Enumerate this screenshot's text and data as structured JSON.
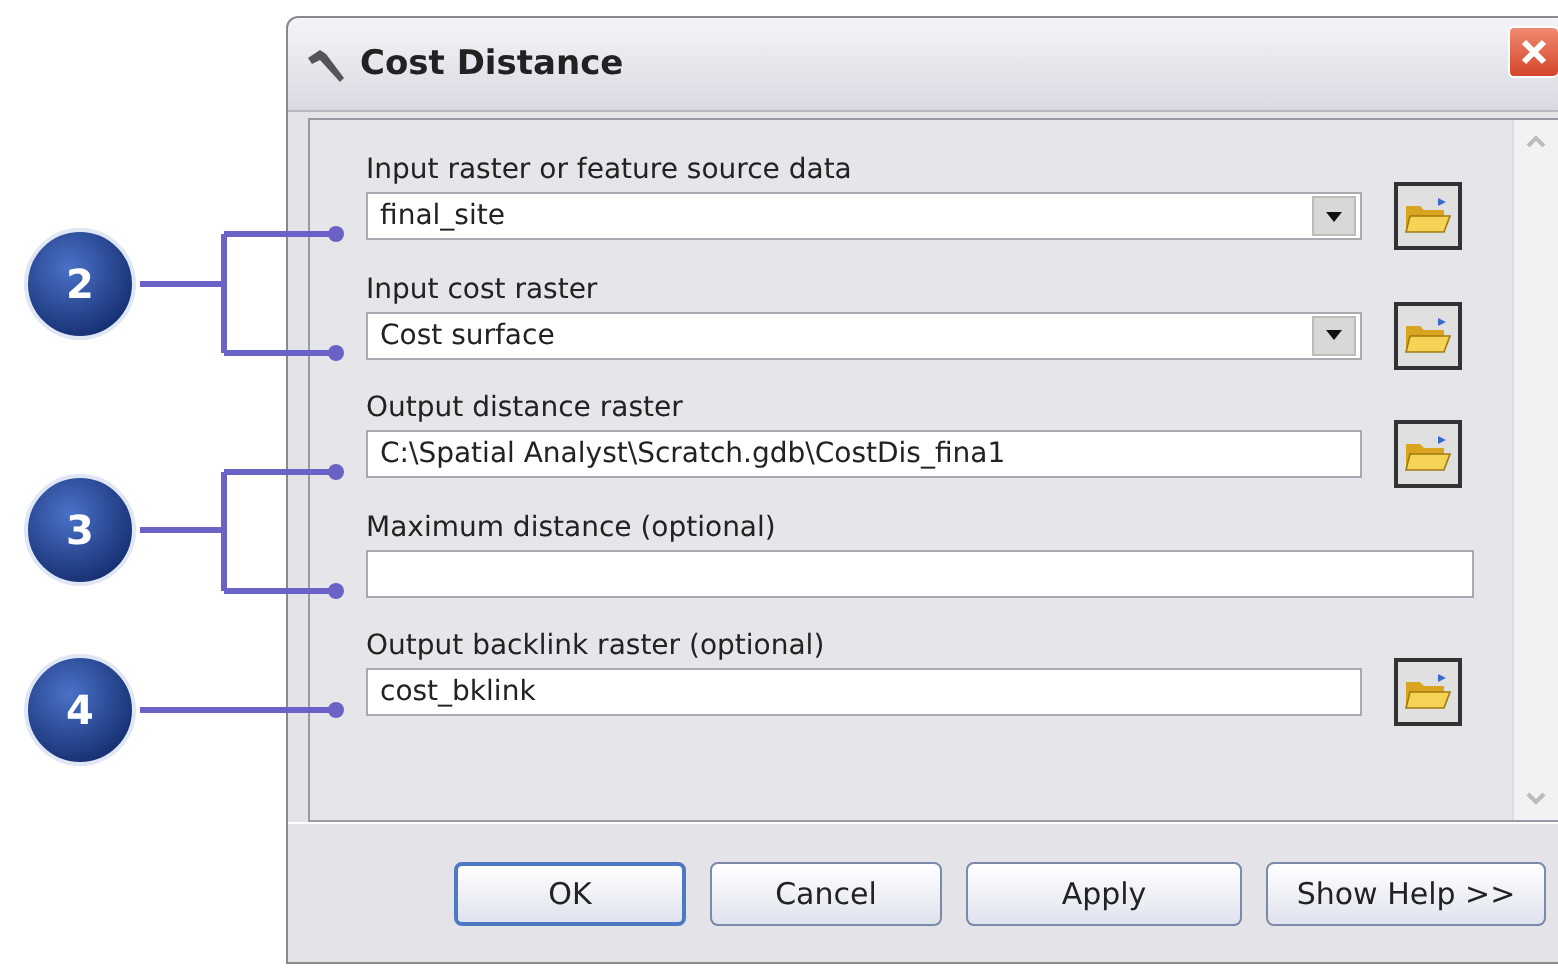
{
  "window": {
    "title": "Cost Distance"
  },
  "fields": [
    {
      "label": "Input raster or feature source data",
      "kind": "dropdown",
      "value": "final_site",
      "browse": true
    },
    {
      "label": "Input cost raster",
      "kind": "dropdown",
      "value": "Cost surface",
      "browse": true
    },
    {
      "label": "Output distance raster",
      "kind": "text",
      "value": "C:\\Spatial  Analyst\\Scratch.gdb\\CostDis_fina1",
      "browse": true
    },
    {
      "label": "Maximum distance (optional)",
      "kind": "text",
      "browse": false
    },
    {
      "label": "Output backlink raster (optional)",
      "kind": "text",
      "value": "cost_bklink",
      "browse": true
    }
  ],
  "buttons": [
    {
      "label": "OK",
      "default": true
    },
    {
      "label": "Cancel",
      "default": false
    },
    {
      "label": "Apply",
      "default": false
    },
    {
      "label": "Show Help >>",
      "default": false
    }
  ],
  "callouts": [
    {
      "number": "2"
    },
    {
      "number": "3"
    },
    {
      "number": "4"
    }
  ]
}
